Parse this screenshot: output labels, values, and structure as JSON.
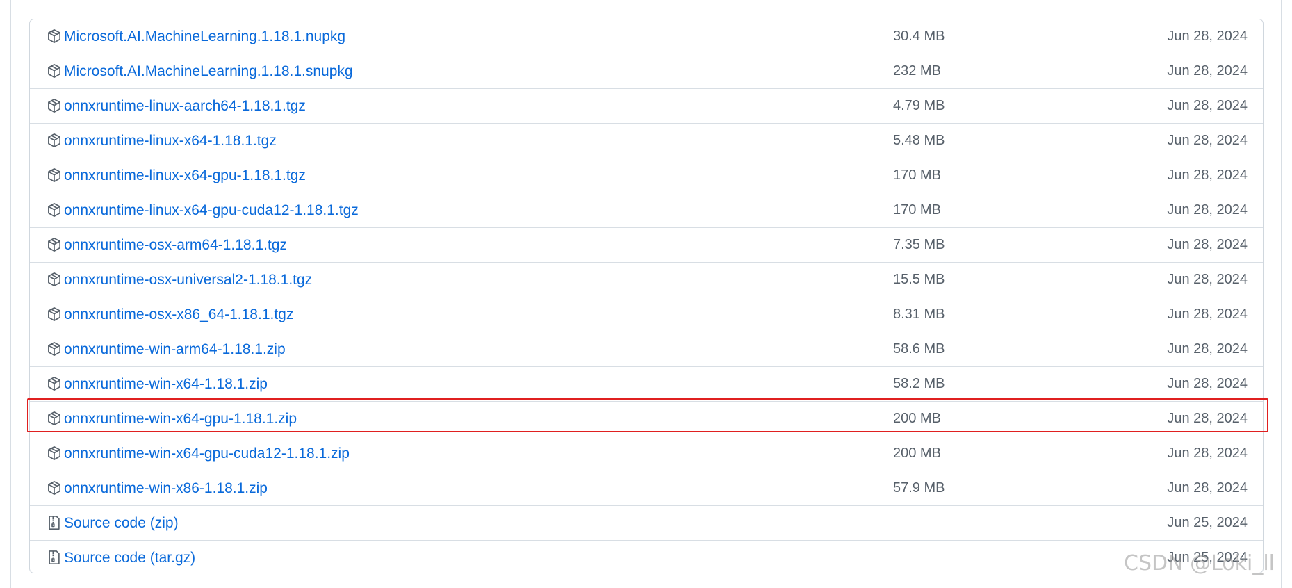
{
  "assets": [
    {
      "name": "Microsoft.AI.MachineLearning.1.18.1.nupkg",
      "suffix": "",
      "size": "30.4 MB",
      "date": "Jun 28, 2024",
      "icon": "package-icon"
    },
    {
      "name": "Microsoft.AI.MachineLearning.1.18.1.snupkg",
      "suffix": "",
      "size": "232 MB",
      "date": "Jun 28, 2024",
      "icon": "package-icon"
    },
    {
      "name": "onnxruntime-linux-aarch64-1.18.1.tgz",
      "suffix": "",
      "size": "4.79 MB",
      "date": "Jun 28, 2024",
      "icon": "package-icon"
    },
    {
      "name": "onnxruntime-linux-x64-1.18.1.tgz",
      "suffix": "",
      "size": "5.48 MB",
      "date": "Jun 28, 2024",
      "icon": "package-icon"
    },
    {
      "name": "onnxruntime-linux-x64-gpu-1.18.1.tgz",
      "suffix": "",
      "size": "170 MB",
      "date": "Jun 28, 2024",
      "icon": "package-icon"
    },
    {
      "name": "onnxruntime-linux-x64-gpu-cuda12-1.18.1.tgz",
      "suffix": "",
      "size": "170 MB",
      "date": "Jun 28, 2024",
      "icon": "package-icon"
    },
    {
      "name": "onnxruntime-osx-arm64-1.18.1.tgz",
      "suffix": "",
      "size": "7.35 MB",
      "date": "Jun 28, 2024",
      "icon": "package-icon"
    },
    {
      "name": "onnxruntime-osx-universal2-1.18.1.tgz",
      "suffix": "",
      "size": "15.5 MB",
      "date": "Jun 28, 2024",
      "icon": "package-icon"
    },
    {
      "name": "onnxruntime-osx-x86_64-1.18.1.tgz",
      "suffix": "",
      "size": "8.31 MB",
      "date": "Jun 28, 2024",
      "icon": "package-icon"
    },
    {
      "name": "onnxruntime-win-arm64-1.18.1.zip",
      "suffix": "",
      "size": "58.6 MB",
      "date": "Jun 28, 2024",
      "icon": "package-icon"
    },
    {
      "name": "onnxruntime-win-x64-1.18.1.zip",
      "suffix": "",
      "size": "58.2 MB",
      "date": "Jun 28, 2024",
      "icon": "package-icon"
    },
    {
      "name": "onnxruntime-win-x64-gpu-1.18.1.zip",
      "suffix": "",
      "size": "200 MB",
      "date": "Jun 28, 2024",
      "icon": "package-icon",
      "highlighted": true
    },
    {
      "name": "onnxruntime-win-x64-gpu-cuda12-1.18.1.zip",
      "suffix": "",
      "size": "200 MB",
      "date": "Jun 28, 2024",
      "icon": "package-icon"
    },
    {
      "name": "onnxruntime-win-x86-1.18.1.zip",
      "suffix": "",
      "size": "57.9 MB",
      "date": "Jun 28, 2024",
      "icon": "package-icon"
    },
    {
      "name": "Source code",
      "suffix": "(zip)",
      "size": "",
      "date": "Jun 25, 2024",
      "icon": "file-zip-icon"
    },
    {
      "name": "Source code",
      "suffix": "(tar.gz)",
      "size": "",
      "date": "Jun 25, 2024",
      "icon": "file-zip-icon"
    }
  ],
  "colors": {
    "link": "#0969da",
    "muted_text": "#57606a",
    "border": "#d0d7de",
    "highlight": "#e02020"
  },
  "watermark": "CSDN @Loki_ll"
}
